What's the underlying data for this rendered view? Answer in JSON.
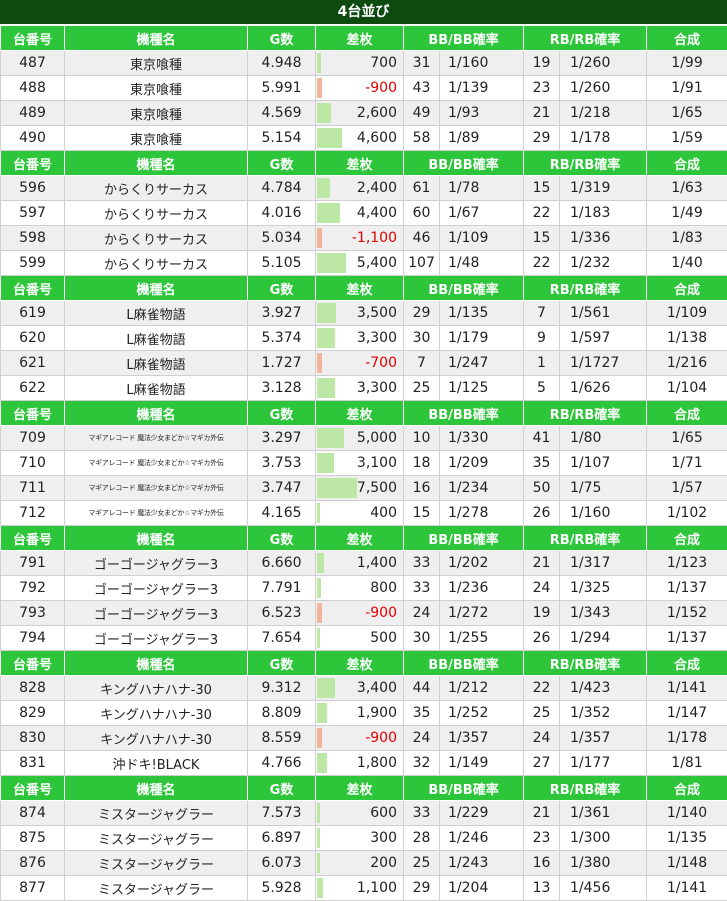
{
  "title": "4台並び",
  "headers": [
    "台番号",
    "機種名",
    "G数",
    "差枚",
    "BB/BB確率",
    "RB/RB確率",
    "合成"
  ],
  "colors": {
    "title_bg": "#0d4a10",
    "header_bg": "#2dc53a",
    "positive_bar": "#bde7a5",
    "negative_bar": "#f2b49b",
    "negative_text": "#e00000"
  },
  "diff_scale_max": 7500,
  "groups": [
    {
      "rows": [
        {
          "no": "487",
          "name": "東京喰種",
          "games": "4.948",
          "diff": "700",
          "diff_value": 700,
          "bb": "31",
          "bb_rate": "1/160",
          "rb": "19",
          "rb_rate": "1/260",
          "combined": "1/99"
        },
        {
          "no": "488",
          "name": "東京喰種",
          "games": "5.991",
          "diff": "-900",
          "diff_value": -900,
          "bb": "43",
          "bb_rate": "1/139",
          "rb": "23",
          "rb_rate": "1/260",
          "combined": "1/91"
        },
        {
          "no": "489",
          "name": "東京喰種",
          "games": "4.569",
          "diff": "2,600",
          "diff_value": 2600,
          "bb": "49",
          "bb_rate": "1/93",
          "rb": "21",
          "rb_rate": "1/218",
          "combined": "1/65"
        },
        {
          "no": "490",
          "name": "東京喰種",
          "games": "5.154",
          "diff": "4,600",
          "diff_value": 4600,
          "bb": "58",
          "bb_rate": "1/89",
          "rb": "29",
          "rb_rate": "1/178",
          "combined": "1/59"
        }
      ]
    },
    {
      "rows": [
        {
          "no": "596",
          "name": "からくりサーカス",
          "games": "4.784",
          "diff": "2,400",
          "diff_value": 2400,
          "bb": "61",
          "bb_rate": "1/78",
          "rb": "15",
          "rb_rate": "1/319",
          "combined": "1/63"
        },
        {
          "no": "597",
          "name": "からくりサーカス",
          "games": "4.016",
          "diff": "4,400",
          "diff_value": 4400,
          "bb": "60",
          "bb_rate": "1/67",
          "rb": "22",
          "rb_rate": "1/183",
          "combined": "1/49"
        },
        {
          "no": "598",
          "name": "からくりサーカス",
          "games": "5.034",
          "diff": "-1,100",
          "diff_value": -1100,
          "bb": "46",
          "bb_rate": "1/109",
          "rb": "15",
          "rb_rate": "1/336",
          "combined": "1/83"
        },
        {
          "no": "599",
          "name": "からくりサーカス",
          "games": "5.105",
          "diff": "5,400",
          "diff_value": 5400,
          "bb": "107",
          "bb_rate": "1/48",
          "rb": "22",
          "rb_rate": "1/232",
          "combined": "1/40"
        }
      ]
    },
    {
      "rows": [
        {
          "no": "619",
          "name": "L麻雀物語",
          "games": "3.927",
          "diff": "3,500",
          "diff_value": 3500,
          "bb": "29",
          "bb_rate": "1/135",
          "rb": "7",
          "rb_rate": "1/561",
          "combined": "1/109"
        },
        {
          "no": "620",
          "name": "L麻雀物語",
          "games": "5.374",
          "diff": "3,300",
          "diff_value": 3300,
          "bb": "30",
          "bb_rate": "1/179",
          "rb": "9",
          "rb_rate": "1/597",
          "combined": "1/138"
        },
        {
          "no": "621",
          "name": "L麻雀物語",
          "games": "1.727",
          "diff": "-700",
          "diff_value": -700,
          "bb": "7",
          "bb_rate": "1/247",
          "rb": "1",
          "rb_rate": "1/1727",
          "combined": "1/216"
        },
        {
          "no": "622",
          "name": "L麻雀物語",
          "games": "3.128",
          "diff": "3,300",
          "diff_value": 3300,
          "bb": "25",
          "bb_rate": "1/125",
          "rb": "5",
          "rb_rate": "1/626",
          "combined": "1/104"
        }
      ]
    },
    {
      "tiny_name": true,
      "rows": [
        {
          "no": "709",
          "name": "マギアレコード 魔法少女まどか☆マギカ外伝",
          "games": "3.297",
          "diff": "5,000",
          "diff_value": 5000,
          "bb": "10",
          "bb_rate": "1/330",
          "rb": "41",
          "rb_rate": "1/80",
          "combined": "1/65"
        },
        {
          "no": "710",
          "name": "マギアレコード 魔法少女まどか☆マギカ外伝",
          "games": "3.753",
          "diff": "3,100",
          "diff_value": 3100,
          "bb": "18",
          "bb_rate": "1/209",
          "rb": "35",
          "rb_rate": "1/107",
          "combined": "1/71"
        },
        {
          "no": "711",
          "name": "マギアレコード 魔法少女まどか☆マギカ外伝",
          "games": "3.747",
          "diff": "7,500",
          "diff_value": 7500,
          "bb": "16",
          "bb_rate": "1/234",
          "rb": "50",
          "rb_rate": "1/75",
          "combined": "1/57"
        },
        {
          "no": "712",
          "name": "マギアレコード 魔法少女まどか☆マギカ外伝",
          "games": "4.165",
          "diff": "400",
          "diff_value": 400,
          "bb": "15",
          "bb_rate": "1/278",
          "rb": "26",
          "rb_rate": "1/160",
          "combined": "1/102"
        }
      ]
    },
    {
      "rows": [
        {
          "no": "791",
          "name": "ゴーゴージャグラー3",
          "games": "6.660",
          "diff": "1,400",
          "diff_value": 1400,
          "bb": "33",
          "bb_rate": "1/202",
          "rb": "21",
          "rb_rate": "1/317",
          "combined": "1/123"
        },
        {
          "no": "792",
          "name": "ゴーゴージャグラー3",
          "games": "7.791",
          "diff": "800",
          "diff_value": 800,
          "bb": "33",
          "bb_rate": "1/236",
          "rb": "24",
          "rb_rate": "1/325",
          "combined": "1/137"
        },
        {
          "no": "793",
          "name": "ゴーゴージャグラー3",
          "games": "6.523",
          "diff": "-900",
          "diff_value": -900,
          "bb": "24",
          "bb_rate": "1/272",
          "rb": "19",
          "rb_rate": "1/343",
          "combined": "1/152"
        },
        {
          "no": "794",
          "name": "ゴーゴージャグラー3",
          "games": "7.654",
          "diff": "500",
          "diff_value": 500,
          "bb": "30",
          "bb_rate": "1/255",
          "rb": "26",
          "rb_rate": "1/294",
          "combined": "1/137"
        }
      ]
    },
    {
      "rows": [
        {
          "no": "828",
          "name": "キングハナハナ-30",
          "games": "9.312",
          "diff": "3,400",
          "diff_value": 3400,
          "bb": "44",
          "bb_rate": "1/212",
          "rb": "22",
          "rb_rate": "1/423",
          "combined": "1/141"
        },
        {
          "no": "829",
          "name": "キングハナハナ-30",
          "games": "8.809",
          "diff": "1,900",
          "diff_value": 1900,
          "bb": "35",
          "bb_rate": "1/252",
          "rb": "25",
          "rb_rate": "1/352",
          "combined": "1/147"
        },
        {
          "no": "830",
          "name": "キングハナハナ-30",
          "games": "8.559",
          "diff": "-900",
          "diff_value": -900,
          "bb": "24",
          "bb_rate": "1/357",
          "rb": "24",
          "rb_rate": "1/357",
          "combined": "1/178"
        },
        {
          "no": "831",
          "name": "沖ドキ!BLACK",
          "games": "4.766",
          "diff": "1,800",
          "diff_value": 1800,
          "bb": "32",
          "bb_rate": "1/149",
          "rb": "27",
          "rb_rate": "1/177",
          "combined": "1/81"
        }
      ]
    },
    {
      "rows": [
        {
          "no": "874",
          "name": "ミスタージャグラー",
          "games": "7.573",
          "diff": "600",
          "diff_value": 600,
          "bb": "33",
          "bb_rate": "1/229",
          "rb": "21",
          "rb_rate": "1/361",
          "combined": "1/140"
        },
        {
          "no": "875",
          "name": "ミスタージャグラー",
          "games": "6.897",
          "diff": "300",
          "diff_value": 300,
          "bb": "28",
          "bb_rate": "1/246",
          "rb": "23",
          "rb_rate": "1/300",
          "combined": "1/135"
        },
        {
          "no": "876",
          "name": "ミスタージャグラー",
          "games": "6.073",
          "diff": "200",
          "diff_value": 200,
          "bb": "25",
          "bb_rate": "1/243",
          "rb": "16",
          "rb_rate": "1/380",
          "combined": "1/148"
        },
        {
          "no": "877",
          "name": "ミスタージャグラー",
          "games": "5.928",
          "diff": "1,100",
          "diff_value": 1100,
          "bb": "29",
          "bb_rate": "1/204",
          "rb": "13",
          "rb_rate": "1/456",
          "combined": "1/141"
        }
      ]
    }
  ]
}
